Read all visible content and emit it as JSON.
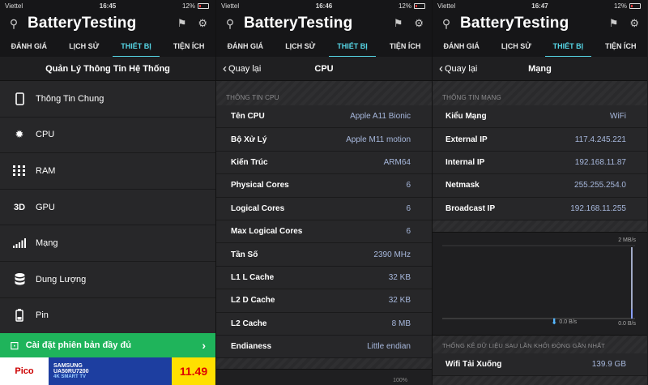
{
  "screens": [
    {
      "status": {
        "carrier": "Viettel",
        "time": "16:45",
        "battery": "12%"
      },
      "app_title": "BatteryTesting",
      "tabs": [
        "ĐÁNH GIÁ",
        "LỊCH SỬ",
        "THIẾT BỊ",
        "TIỆN ÍCH"
      ],
      "active_tab": 2,
      "nav_title": "Quản Lý Thông Tin Hệ Thống",
      "menu": [
        {
          "label": "Thông Tin Chung",
          "icon": "phone-icon"
        },
        {
          "label": "CPU",
          "icon": "gear-icon"
        },
        {
          "label": "RAM",
          "icon": "memory-grid-icon"
        },
        {
          "label": "GPU",
          "icon": "3d-icon"
        },
        {
          "label": "Mạng",
          "icon": "signal-bars-icon"
        },
        {
          "label": "Dung Lượng",
          "icon": "database-icon"
        },
        {
          "label": "Pin",
          "icon": "battery-icon"
        }
      ],
      "banner": {
        "label": "Cài đặt phiên bản đầy đủ"
      },
      "ad": {
        "brand": "Pico",
        "product": "SAMSUNG",
        "model": "UA50RU7200",
        "tag": "4K SMART TV",
        "price": "11.49"
      }
    },
    {
      "status": {
        "carrier": "Viettel",
        "time": "16:46",
        "battery": "12%"
      },
      "app_title": "BatteryTesting",
      "tabs": [
        "ĐÁNH GIÁ",
        "LỊCH SỬ",
        "THIẾT BỊ",
        "TIỆN ÍCH"
      ],
      "back_label": "Quay lại",
      "nav_title": "CPU",
      "section": "THÔNG TIN CPU",
      "rows": [
        {
          "k": "Tên CPU",
          "v": "Apple A11 Bionic"
        },
        {
          "k": "Bộ Xử Lý",
          "v": "Apple M11 motion"
        },
        {
          "k": "Kiến Trúc",
          "v": "ARM64"
        },
        {
          "k": "Physical Cores",
          "v": "6"
        },
        {
          "k": "Logical Cores",
          "v": "6"
        },
        {
          "k": "Max Logical Cores",
          "v": "6"
        },
        {
          "k": "Tần Số",
          "v": "2390 MHz"
        },
        {
          "k": "L1 L Cache",
          "v": "32 KB"
        },
        {
          "k": "L2 D Cache",
          "v": "32 KB"
        },
        {
          "k": "L2 Cache",
          "v": "8 MB"
        },
        {
          "k": "Endianess",
          "v": "Little endian"
        }
      ],
      "footer_percent": "100%"
    },
    {
      "status": {
        "carrier": "Viettel",
        "time": "16:47",
        "battery": "12%"
      },
      "app_title": "BatteryTesting",
      "tabs": [
        "ĐÁNH GIÁ",
        "LỊCH SỬ",
        "THIẾT BỊ",
        "TIỆN ÍCH"
      ],
      "back_label": "Quay lại",
      "nav_title": "Mạng",
      "section": "THÔNG TIN MẠNG",
      "rows": [
        {
          "k": "Kiểu Mạng",
          "v": "WiFi"
        },
        {
          "k": "External IP",
          "v": "117.4.245.221"
        },
        {
          "k": "Internal IP",
          "v": "192.168.11.87"
        },
        {
          "k": "Netmask",
          "v": "255.255.254.0"
        },
        {
          "k": "Broadcast IP",
          "v": "192.168.11.255"
        }
      ],
      "graph": {
        "max_label": "2 MB/s",
        "down_rate": "0.0 B/s",
        "up_rate": "0.0 B/s"
      },
      "section2": "THỐNG KÊ DỮ LIỆU SAU LẦN KHỞI ĐỘNG GẦN NHẤT",
      "rows2": [
        {
          "k": "Wifi Tải Xuống",
          "v": "139.9 GB"
        }
      ]
    }
  ],
  "colors": {
    "accent": "#56d6e6",
    "banner": "#1fb45b",
    "value": "#a7b8dd"
  }
}
